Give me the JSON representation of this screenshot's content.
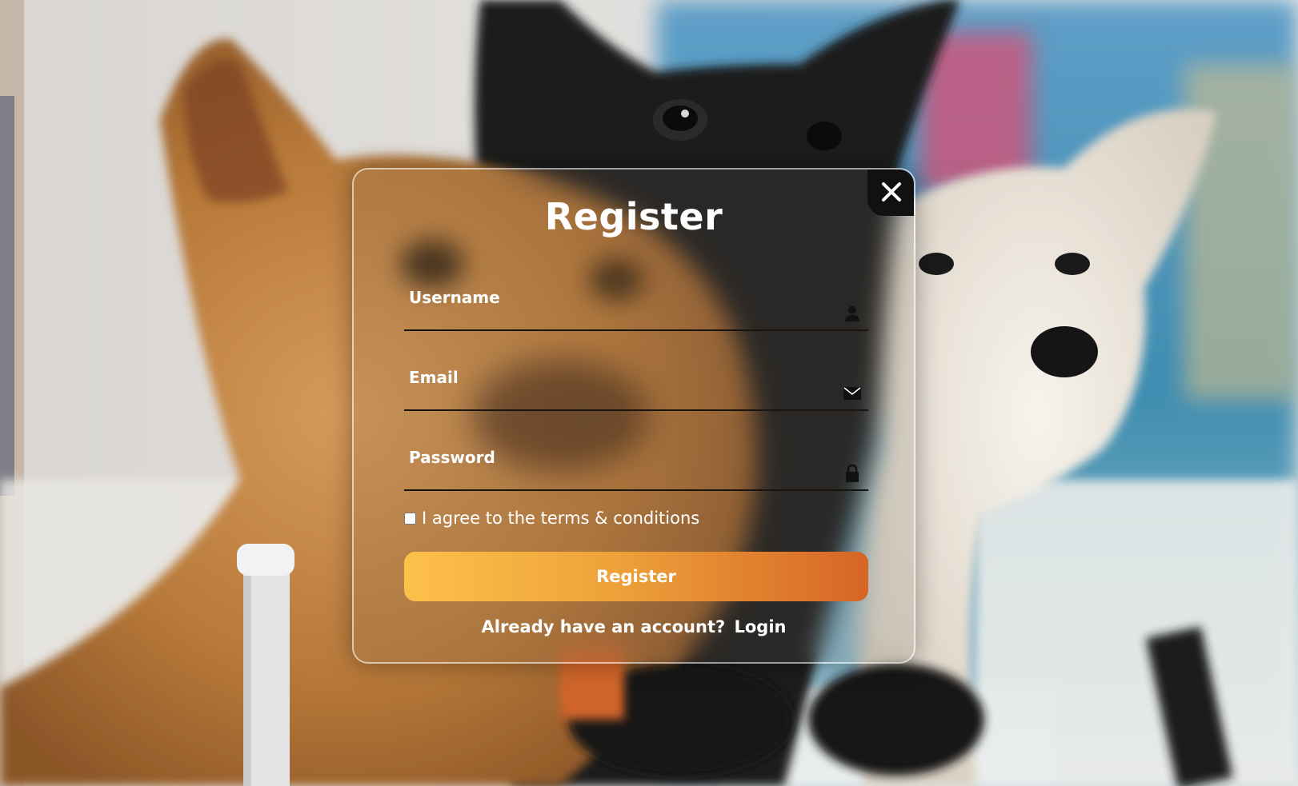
{
  "modal": {
    "title": "Register",
    "close_icon": "close-icon",
    "fields": {
      "username": {
        "label": "Username",
        "value": "",
        "icon": "user-icon"
      },
      "email": {
        "label": "Email",
        "value": "",
        "icon": "mail-icon"
      },
      "password": {
        "label": "Password",
        "value": "",
        "icon": "lock-icon"
      }
    },
    "terms_label": "I agree to the terms & conditions",
    "terms_checked": false,
    "register_button": "Register",
    "login_prompt": "Already have an account?",
    "login_link": "Login"
  },
  "colors": {
    "button_gradient_start": "#fdc14a",
    "button_gradient_end": "#d76526",
    "close_bg": "#111111",
    "text": "#ffffff"
  }
}
